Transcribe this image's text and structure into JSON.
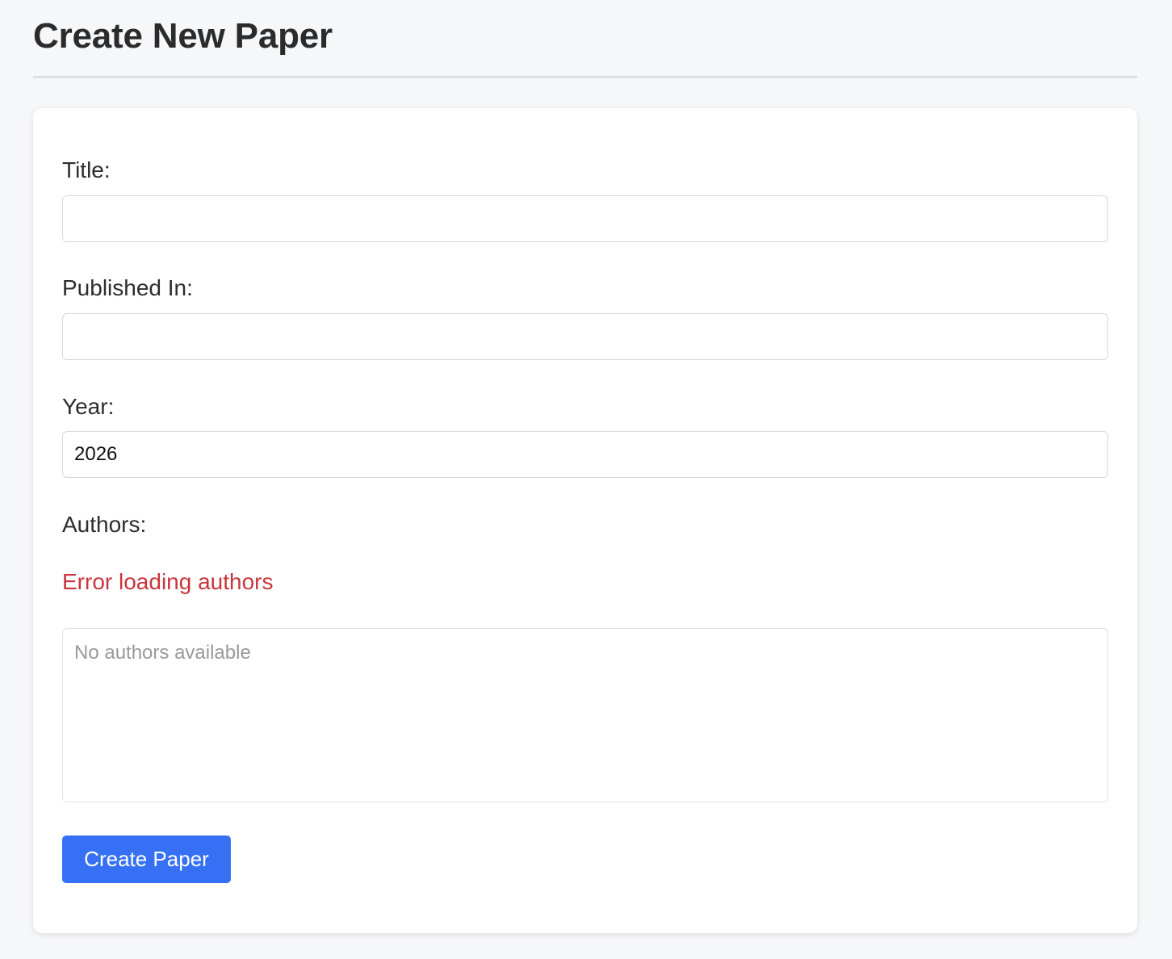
{
  "header": {
    "title": "Create New Paper"
  },
  "form": {
    "title_label": "Title:",
    "title_value": "",
    "published_in_label": "Published In:",
    "published_in_value": "",
    "year_label": "Year:",
    "year_value": "2026",
    "authors_label": "Authors:",
    "authors_error": "Error loading authors",
    "authors_empty": "No authors available",
    "submit_label": "Create Paper"
  },
  "colors": {
    "accent": "#3671f5",
    "error": "#c9353d",
    "background": "#f6f7f9"
  }
}
